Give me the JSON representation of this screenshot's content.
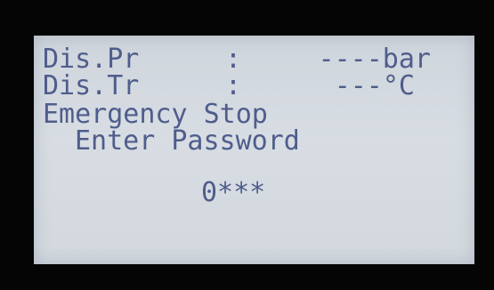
{
  "display": {
    "discharge_pressure": {
      "label": "Dis.Pr",
      "separator": ":",
      "value": "----bar"
    },
    "discharge_temperature": {
      "label": "Dis.Tr",
      "separator": ":",
      "value": "---°C"
    },
    "status_message": "Emergency Stop",
    "prompt": "Enter Password",
    "password_entry": "0***"
  },
  "colors": {
    "lcd_background": "#d3d9df",
    "lcd_text": "#4f5d8c",
    "bezel": "#050505"
  }
}
